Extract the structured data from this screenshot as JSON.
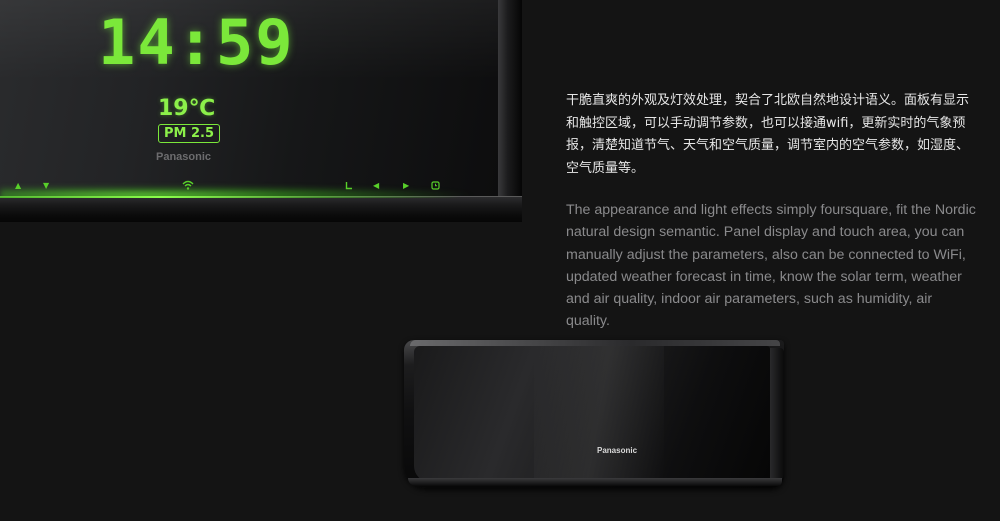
{
  "display": {
    "time": "14:59",
    "temperature": "19℃",
    "pm_badge": "PM 2.5",
    "brand_small": "Panasonic",
    "icons": [
      "up-arrow",
      "down-arrow",
      "wifi",
      "L-mode",
      "left-arrow",
      "right-arrow",
      "timer"
    ]
  },
  "description": {
    "chinese": "干脆直爽的外观及灯效处理，契合了北欧自然地设计语义。面板有显示和触控区域，可以手动调节参数，也可以接通wifi，更新实时的气象预报，清楚知道节气、天气和空气质量，调节室内的空气参数，如湿度、空气质量等。",
    "english": "The appearance and light effects simply foursquare, fit the Nordic natural design semantic. Panel display and touch area, you can manually adjust the parameters, also can be connected to WiFi, updated weather forecast in time, know the solar term, weather and air quality, indoor air parameters, such as humidity, air quality."
  },
  "unit": {
    "brand": "Panasonic"
  },
  "colors": {
    "background": "#141414",
    "display_green": "#7be83a",
    "cn_text": "#e6e6e6",
    "en_text": "#8a8a8c"
  }
}
